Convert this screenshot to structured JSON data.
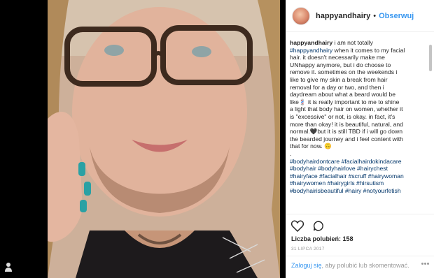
{
  "post": {
    "username": "happyandhairy",
    "follow_label": "Obserwuj",
    "separator": "•",
    "caption_lines": [
      "happyandhairy i am not totally",
      "#happyandhairy when it comes to my facial",
      "hair. it doesn't necessarily make me",
      "UNhappy anymore, but i do choose to",
      "remove it. sometimes on the weekends i",
      "like to give my skin a break from hair",
      "removal for a day or two, and then i",
      "daydream about what a beard would be",
      "like💈 it is really important to me to shine",
      "a light that body hair on women, whether it",
      "is \"excessive\" or not, is okay. in fact, it's",
      "more than okay! it is beautiful, natural, and",
      "normal.🖤but it is still TBD if i will go down",
      "the bearded journey and i feel content with",
      "that for now. 🙃"
    ],
    "dot_line": ".",
    "hashtag_lines": [
      "#bodyhairdontcare #facialhairdokindacare",
      "#bodyhair #bodyhairlove #hairychest",
      "#hairyface #facialhair #scruff #hairywoman",
      "#hairywomen #hairygirls #hirsutism",
      "#bodyhairisbeautiful #hairy #notyourfetish"
    ],
    "likes_text": "Liczba polubień: 158",
    "date_text": "31 LIPCA 2017",
    "login_link": "Zaloguj się",
    "login_rest": ", aby polubić lub skomentować."
  },
  "icons": {
    "like": "heart-outline",
    "comment": "speech-bubble",
    "more": "ellipsis",
    "profile": "user"
  },
  "colors": {
    "link": "#3897f0",
    "hashtag": "#003569",
    "text": "#262626",
    "muted": "#999999"
  }
}
